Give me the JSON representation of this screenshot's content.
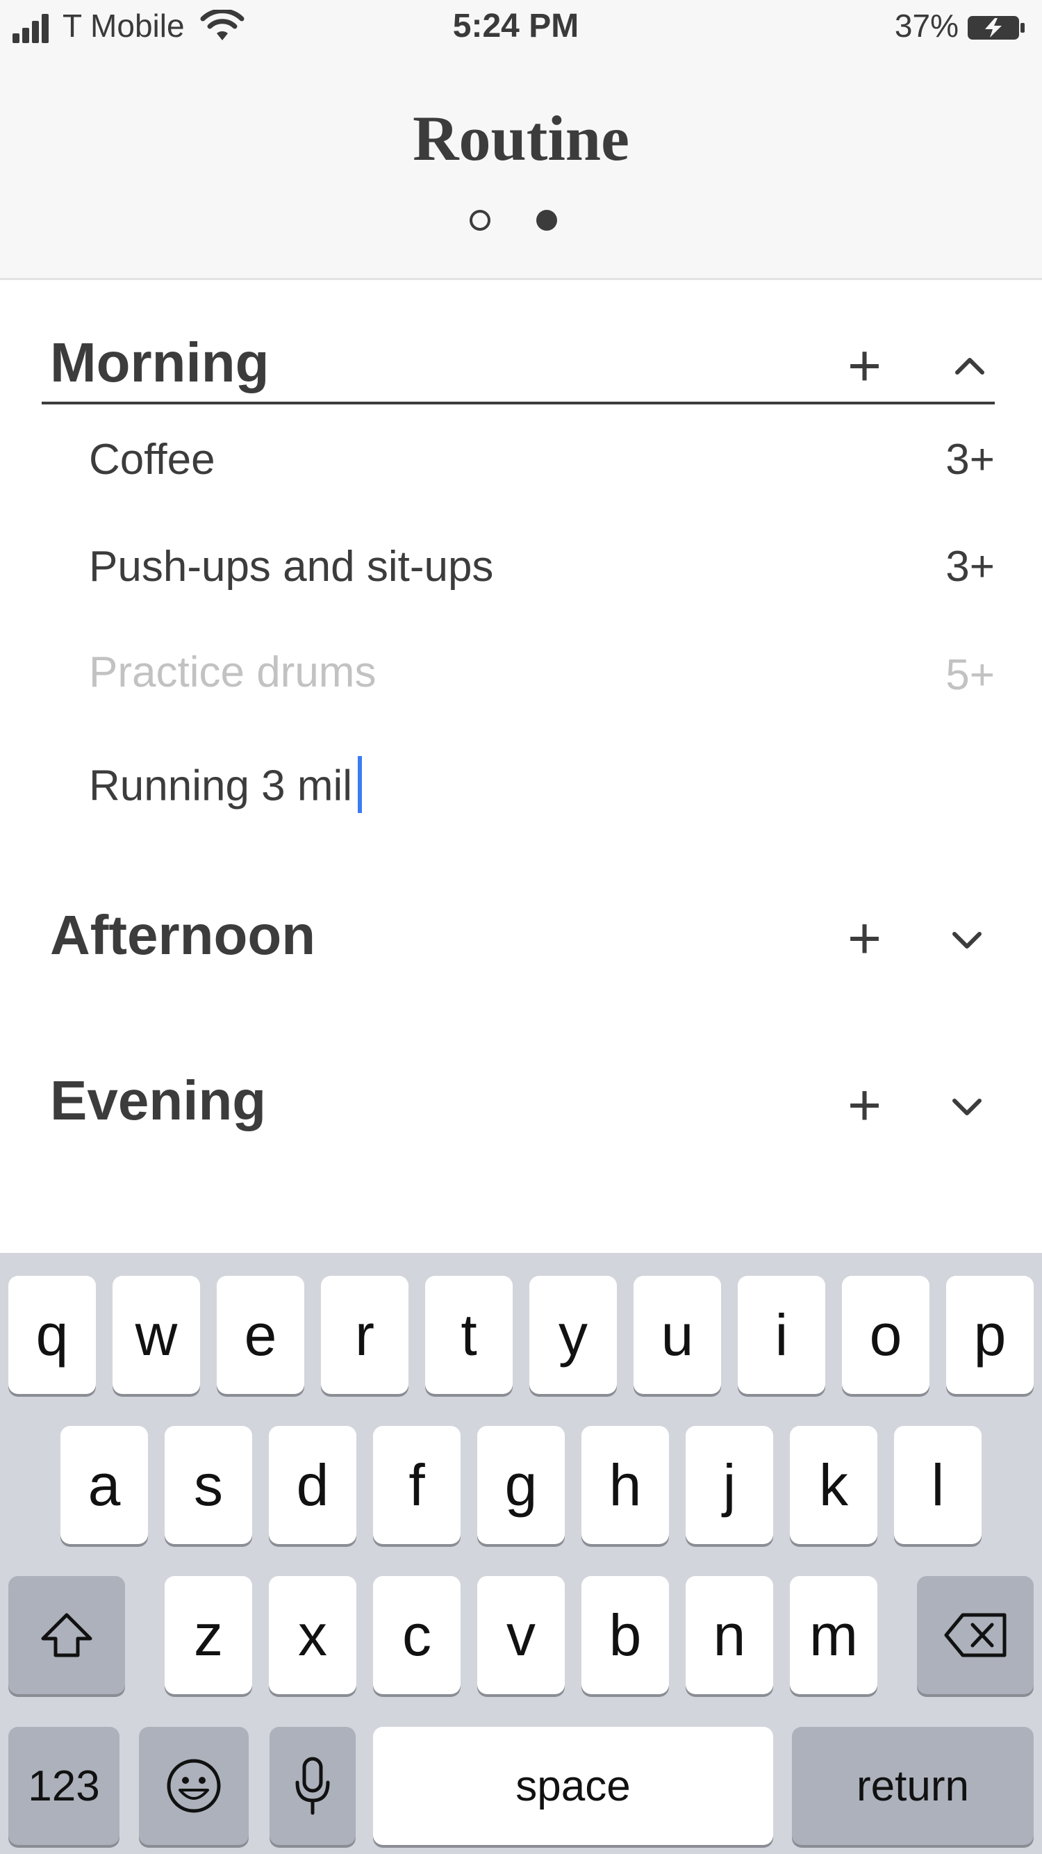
{
  "status_bar": {
    "carrier": "T Mobile",
    "time": "5:24 PM",
    "battery": "37%"
  },
  "header": {
    "title": "Routine",
    "page_dots": [
      "inactive",
      "active"
    ]
  },
  "sections": [
    {
      "title": "Morning",
      "expanded": true,
      "items": [
        {
          "label": "Coffee",
          "count": "3+",
          "dimmed": false
        },
        {
          "label": "Push-ups and sit-ups",
          "count": "3+",
          "dimmed": false
        },
        {
          "label": "Practice drums",
          "count": "5+",
          "dimmed": true
        }
      ],
      "editing_value": "Running 3 mil"
    },
    {
      "title": "Afternoon",
      "expanded": false
    },
    {
      "title": "Evening",
      "expanded": false
    }
  ],
  "keyboard": {
    "row1": [
      "q",
      "w",
      "e",
      "r",
      "t",
      "y",
      "u",
      "i",
      "o",
      "p"
    ],
    "row2": [
      "a",
      "s",
      "d",
      "f",
      "g",
      "h",
      "j",
      "k",
      "l"
    ],
    "row3": [
      "z",
      "x",
      "c",
      "v",
      "b",
      "n",
      "m"
    ],
    "numbers_key": "123",
    "space_key": "space",
    "return_key": "return"
  },
  "colors": {
    "text": "#3c3c3c",
    "dimmed_text": "#c2c2c2",
    "cursor": "#3b7cf5",
    "keyboard_bg": "#d2d5db",
    "key_dark": "#acb1bb"
  }
}
